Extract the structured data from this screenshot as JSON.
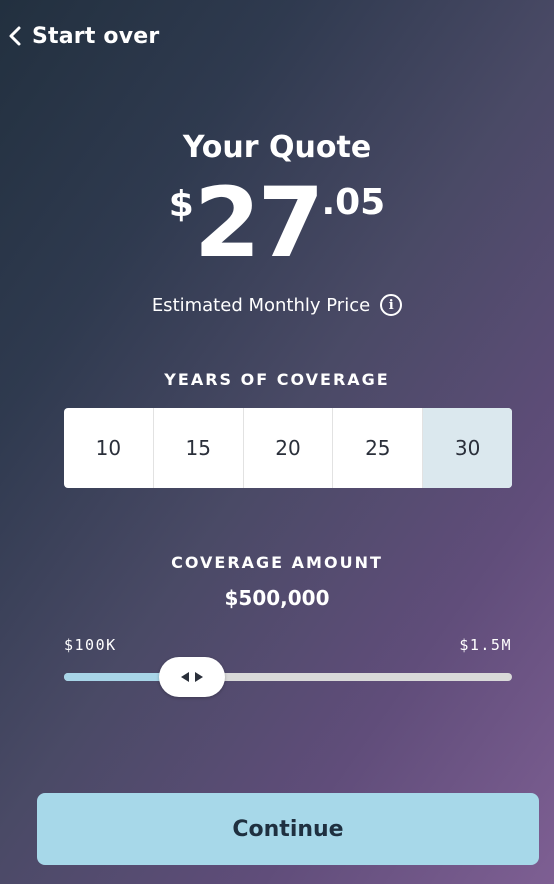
{
  "nav": {
    "back_label": "Start over",
    "back_icon": "chevron-left-icon"
  },
  "quote": {
    "title": "Your Quote",
    "currency_symbol": "$",
    "price_dollars": "27",
    "price_cents": ".05",
    "caption": "Estimated Monthly Price",
    "info_icon": "info-icon"
  },
  "years": {
    "label": "YEARS OF COVERAGE",
    "options": [
      "10",
      "15",
      "20",
      "25",
      "30"
    ],
    "selected": "30"
  },
  "coverage": {
    "label": "COVERAGE AMOUNT",
    "value": "$500,000",
    "min_label": "$100K",
    "max_label": "$1.5M",
    "slider_fraction": 0.2857
  },
  "cta": {
    "continue_label": "Continue"
  },
  "colors": {
    "accent": "#a7d8e9",
    "selected_option": "#dbe8ee",
    "track_fill": "#a8d5e8",
    "track": "#d9d9d9"
  }
}
